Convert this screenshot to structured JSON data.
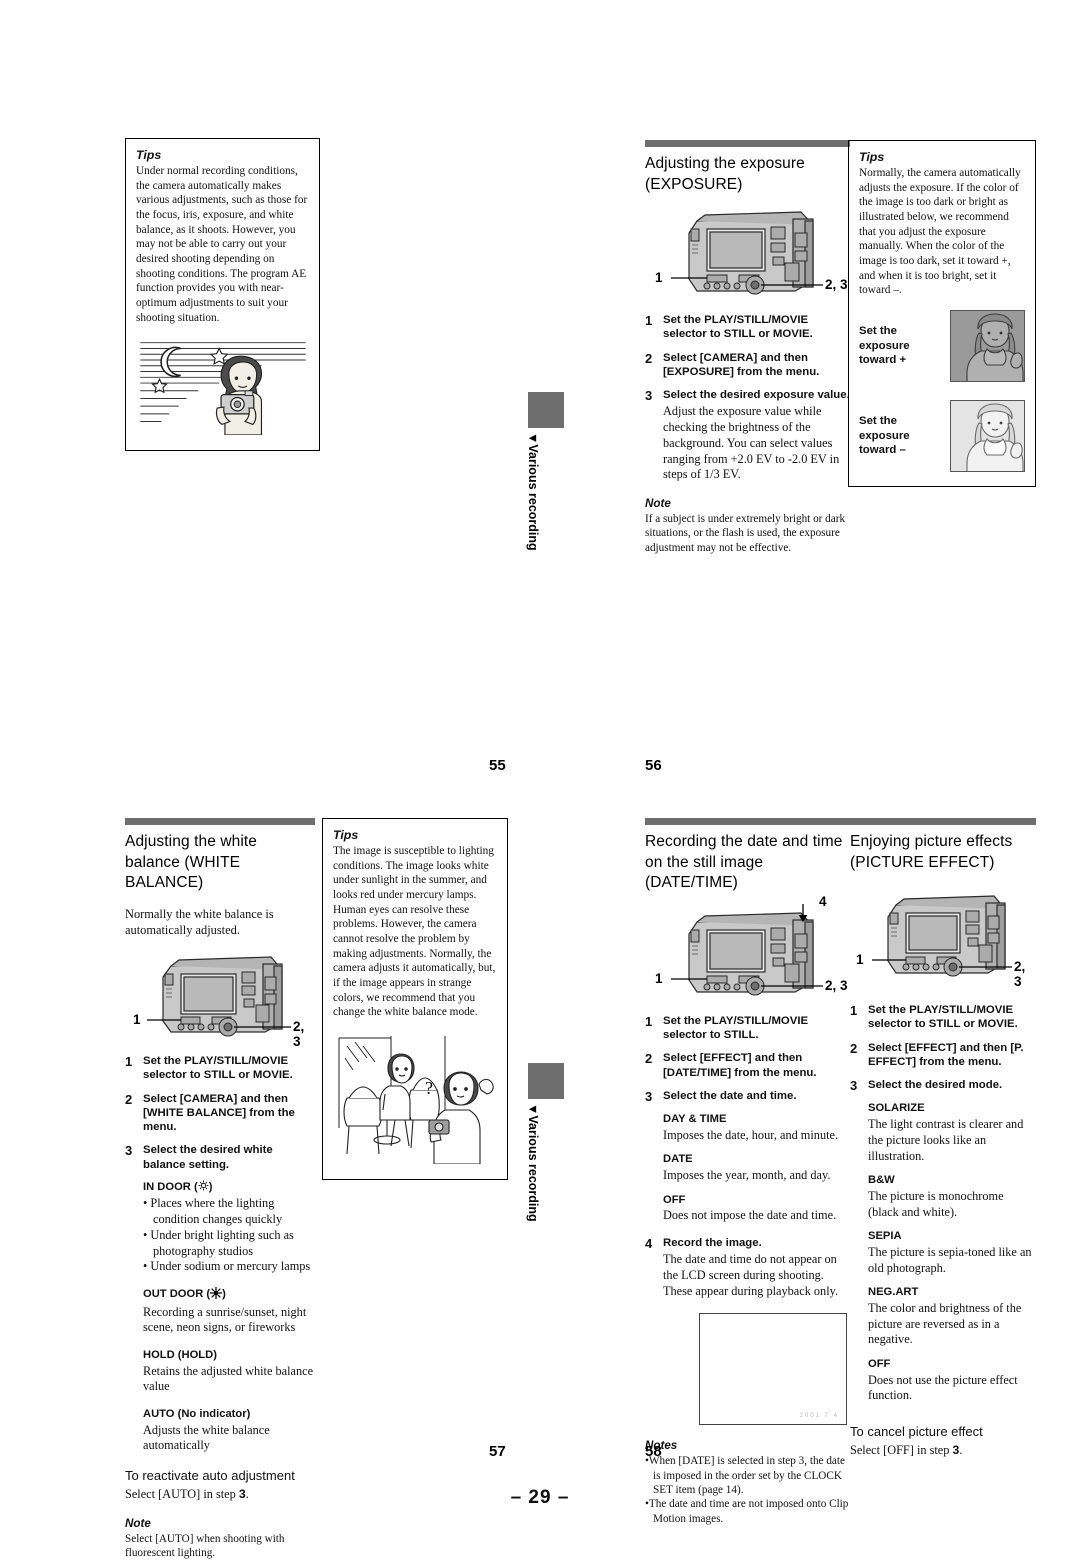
{
  "sheet": {
    "marker": "– 29 –"
  },
  "side_tabs": [
    {
      "label": "▼Various recording"
    },
    {
      "label": "▼Various recording"
    }
  ],
  "pages": [
    {
      "number": "55",
      "tips": {
        "heading": "Tips",
        "body": "Under normal recording conditions, the camera automatically makes various adjustments, such as those for the focus, iris, exposure, and white balance, as it shoots. However, you may not be able to carry out your desired shooting depending on shooting conditions. The program AE function provides you with near-optimum adjustments to suit your shooting situation.",
        "illustration": "night-scene-photographer-illustration"
      }
    },
    {
      "number": "56",
      "title": "Adjusting the exposure (EXPOSURE)",
      "camera": {
        "alt": "camera-rear-view-diagram",
        "callout_left": "1",
        "callout_right": "2, 3"
      },
      "steps": [
        {
          "num": "1",
          "title": "Set the PLAY/STILL/MOVIE selector to STILL or MOVIE.",
          "text": ""
        },
        {
          "num": "2",
          "title": "Select [CAMERA] and then [EXPOSURE] from the menu.",
          "text": ""
        },
        {
          "num": "3",
          "title": "Select the desired exposure value.",
          "text": "Adjust the exposure value while checking the brightness of the background. You can select values ranging from +2.0 EV to -2.0 EV in steps of 1/3 EV."
        }
      ],
      "note": {
        "heading": "Note",
        "body": "If a subject is under extremely bright or dark situations, or the flash is used, the exposure adjustment may not be effective."
      },
      "tips": {
        "heading": "Tips",
        "body": "Normally, the camera automatically adjusts the exposure. If the color of the image is too dark or bright as illustrated below, we recommend that you adjust the exposure manually. When the color of the image is too dark, set it toward +, and when it is too bright, set it toward –.",
        "examples": [
          {
            "label": "Set the exposure toward +",
            "tone": "dark"
          },
          {
            "label": "Set the exposure toward –",
            "tone": "light"
          }
        ]
      }
    },
    {
      "number": "57",
      "title": "Adjusting the white balance (WHITE BALANCE)",
      "lead": "Normally the white balance is automatically adjusted.",
      "camera": {
        "alt": "camera-rear-view-diagram",
        "callout_left": "1",
        "callout_right": "2, 3"
      },
      "steps": [
        {
          "num": "1",
          "title": "Set the PLAY/STILL/MOVIE selector to STILL or MOVIE.",
          "text": ""
        },
        {
          "num": "2",
          "title": "Select [CAMERA] and then [WHITE BALANCE] from the menu.",
          "text": ""
        },
        {
          "num": "3",
          "title": "Select the desired white balance setting.",
          "text": ""
        }
      ],
      "options": [
        {
          "name": "IN DOOR (",
          "icon": "indoor-lamp-icon",
          "name_close": ")",
          "bullets": [
            "Places where the lighting condition changes quickly",
            "Under bright lighting such as photography studios",
            "Under sodium or mercury lamps"
          ]
        },
        {
          "name": "OUT DOOR (",
          "icon": "sun-icon",
          "name_close": ")",
          "desc": "Recording a sunrise/sunset, night scene, neon signs, or fireworks"
        },
        {
          "name": "HOLD (HOLD)",
          "desc": "Retains the adjusted white balance value"
        },
        {
          "name": "AUTO (No indicator)",
          "desc": "Adjusts the white balance automatically"
        }
      ],
      "subhead": {
        "title": "To reactivate auto adjustment",
        "text_pre": "Select [AUTO] in step ",
        "text_bold": "3",
        "text_post": "."
      },
      "note": {
        "heading": "Note",
        "body": "Select [AUTO] when shooting with fluorescent lighting."
      },
      "tips": {
        "heading": "Tips",
        "body": "The image is susceptible to lighting conditions. The image looks white under sunlight in the summer, and looks red under mercury lamps. Human eyes can resolve these problems. However, the camera cannot resolve the problem by making adjustments. Normally, the camera adjusts it automatically, but, if the image appears in strange colors, we recommend that you change the white balance mode.",
        "illustration": "cafe-scene-people-illustration"
      }
    },
    {
      "number": "58",
      "title": "Recording the date and time on the still image (DATE/TIME)",
      "camera": {
        "alt": "camera-rear-view-diagram",
        "callout_left": "1",
        "callout_right": "2, 3",
        "callout_top": "4"
      },
      "steps": [
        {
          "num": "1",
          "title": "Set the PLAY/STILL/MOVIE selector to STILL.",
          "text": ""
        },
        {
          "num": "2",
          "title": "Select [EFFECT] and then [DATE/TIME] from the menu.",
          "text": ""
        },
        {
          "num": "3",
          "title": "Select the date and time.",
          "text": ""
        }
      ],
      "options": [
        {
          "name": "DAY & TIME",
          "desc": "Imposes the date, hour, and minute."
        },
        {
          "name": "DATE",
          "desc": "Imposes the year, month, and day."
        },
        {
          "name": "OFF",
          "desc": "Does not impose the date and time."
        }
      ],
      "step4": {
        "num": "4",
        "title": "Record the image.",
        "text": "The date and time do not appear on the LCD screen during shooting. These appear during playback only."
      },
      "lcd": {
        "stamp": "2001 7 4"
      },
      "notes": {
        "heading": "Notes",
        "items": [
          "When [DATE] is selected in step 3, the date is imposed in the order set by the CLOCK SET item (page 14).",
          "The date and time are not imposed onto Clip Motion images."
        ]
      }
    },
    {
      "number": "",
      "title": "Enjoying picture effects (PICTURE EFFECT)",
      "camera": {
        "alt": "camera-rear-view-diagram",
        "callout_left": "1",
        "callout_right": "2, 3"
      },
      "steps": [
        {
          "num": "1",
          "title": "Set the PLAY/STILL/MOVIE selector to STILL or MOVIE.",
          "text": ""
        },
        {
          "num": "2",
          "title": "Select [EFFECT] and then [P. EFFECT] from the menu.",
          "text": ""
        },
        {
          "num": "3",
          "title": "Select the desired mode.",
          "text": ""
        }
      ],
      "options": [
        {
          "name": "SOLARIZE",
          "desc": "The light contrast is clearer and the picture looks like an illustration."
        },
        {
          "name": "B&W",
          "desc": "The picture is monochrome (black and white)."
        },
        {
          "name": "SEPIA",
          "desc": "The picture is sepia-toned like an old photograph."
        },
        {
          "name": "NEG.ART",
          "desc": "The color and brightness of the picture are reversed as in a negative."
        },
        {
          "name": "OFF",
          "desc": "Does not use the picture effect function."
        }
      ],
      "subhead": {
        "title": "To cancel picture effect",
        "text_pre": "Select [OFF] in step ",
        "text_bold": "3",
        "text_post": "."
      }
    }
  ]
}
